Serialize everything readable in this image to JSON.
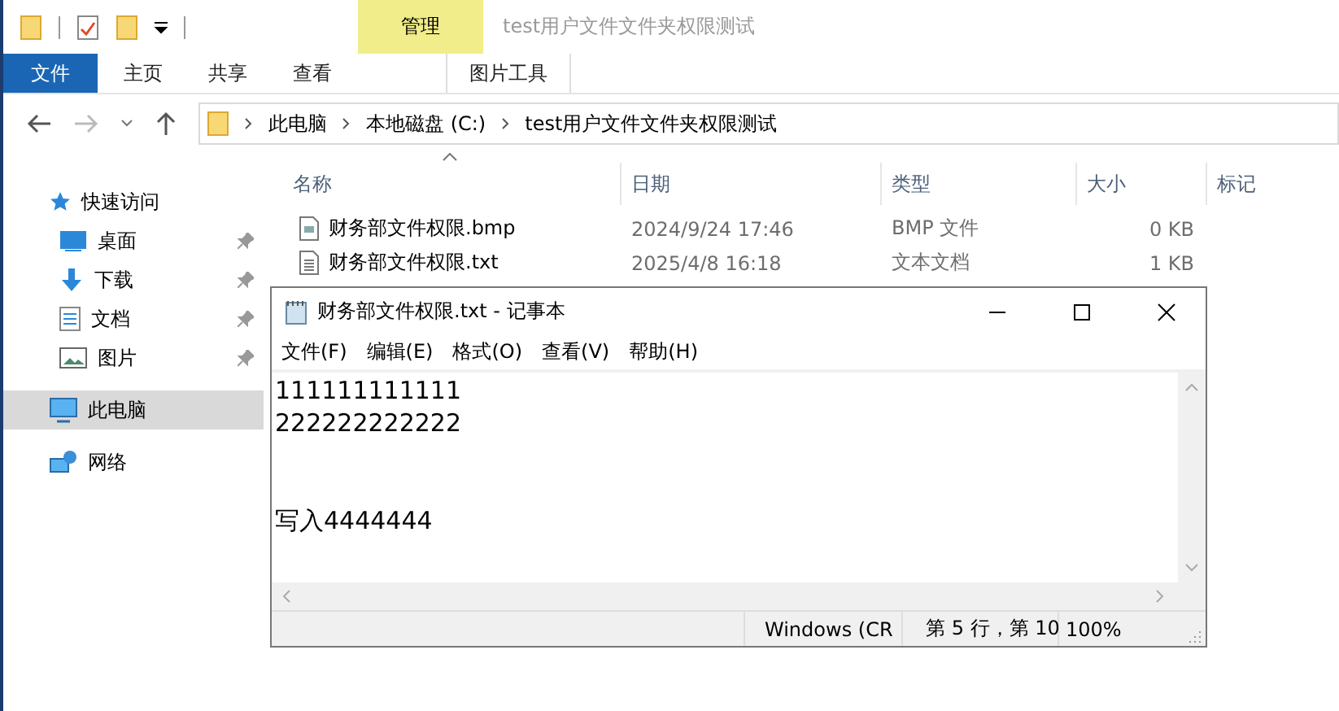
{
  "title_bar": {
    "contextual_tab": "管理",
    "title": "test用户文件文件夹权限测试"
  },
  "ribbon_tabs": [
    {
      "label": "文件",
      "selected": true
    },
    {
      "label": "主页",
      "selected": false
    },
    {
      "label": "共享",
      "selected": false
    },
    {
      "label": "查看",
      "selected": false
    },
    {
      "label": "图片工具",
      "selected": false
    }
  ],
  "address_bar": {
    "path": [
      "此电脑",
      "本地磁盘 (C:)",
      "test用户文件文件夹权限测试"
    ]
  },
  "sidebar": {
    "items": [
      {
        "label": "快速访问",
        "selected": false,
        "children": [
          {
            "label": "桌面",
            "pinned": true,
            "selected": false
          },
          {
            "label": "下载",
            "pinned": true,
            "selected": false
          },
          {
            "label": "文档",
            "pinned": true,
            "selected": false
          },
          {
            "label": "图片",
            "pinned": true,
            "selected": false
          }
        ]
      },
      {
        "label": "此电脑",
        "selected": true
      },
      {
        "label": "网络",
        "selected": false
      }
    ]
  },
  "table": {
    "columns": [
      "名称",
      "日期",
      "类型",
      "大小",
      "标记"
    ],
    "rows": [
      {
        "name": "财务部文件权限.bmp",
        "date": "2024/9/24 17:46",
        "type": "BMP 文件",
        "size": "0 KB"
      },
      {
        "name": "财务部文件权限.txt",
        "date": "2025/4/8 16:18",
        "type": "文本文档",
        "size": "1 KB"
      }
    ]
  },
  "notepad": {
    "title": "财务部文件权限.txt - 记事本",
    "menu": [
      "文件(F)",
      "编辑(E)",
      "格式(O)",
      "查看(V)",
      "帮助(H)"
    ],
    "text": "111111111111\n222222222222\n\n\n写入4444444",
    "status_bar": [
      "Windows (CR",
      "第 5 行，第 10",
      "100%"
    ]
  }
}
